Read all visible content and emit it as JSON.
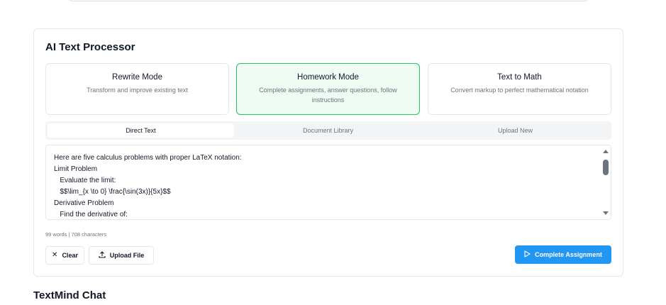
{
  "card": {
    "title": "AI Text Processor"
  },
  "modes": [
    {
      "title": "Rewrite Mode",
      "desc": "Transform and improve existing text",
      "active": false
    },
    {
      "title": "Homework Mode",
      "desc": "Complete assignments, answer questions, follow instructions",
      "active": true
    },
    {
      "title": "Text to Math",
      "desc": "Convert markup to perfect mathematical notation",
      "active": false
    }
  ],
  "tabs": [
    {
      "label": "Direct Text",
      "active": true
    },
    {
      "label": "Document Library",
      "active": false
    },
    {
      "label": "Upload New",
      "active": false
    }
  ],
  "editor": {
    "lines": [
      "Here are five calculus problems with proper LaTeX notation:",
      "Limit Problem",
      "   Evaluate the limit:",
      "   $$\\lim_{x \\to 0} \\frac{\\sin(3x)}{5x}$$",
      "Derivative Problem",
      "   Find the derivative of:"
    ]
  },
  "counter": "99 words | 708 characters",
  "buttons": {
    "clear": "Clear",
    "upload": "Upload File",
    "complete": "Complete Assignment"
  },
  "icons": {
    "clear": "x-icon",
    "upload": "upload-icon",
    "complete": "play-icon"
  },
  "colors": {
    "accent": "#2196f3",
    "active_mode_border": "#22c55e",
    "active_mode_bg": "#effbf3"
  },
  "chat": {
    "title": "TextMind Chat"
  }
}
